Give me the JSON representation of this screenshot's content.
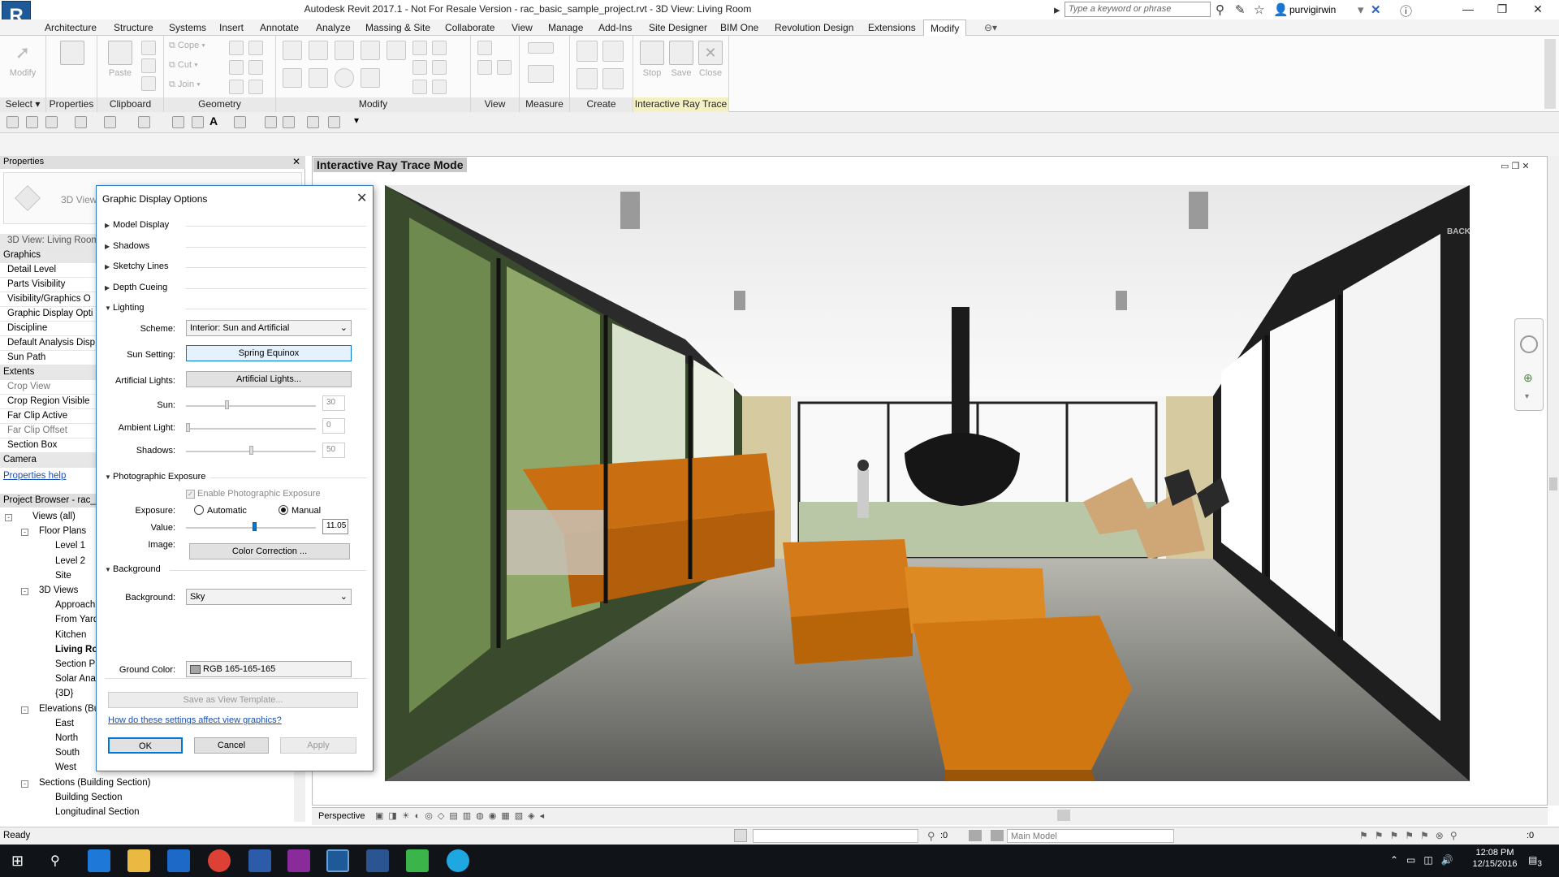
{
  "window": {
    "title": "Autodesk Revit 2017.1 -  Not For Resale Version -    rac_basic_sample_project.rvt - 3D View: Living Room",
    "app_logo": "R",
    "search_placeholder": "Type a keyword or phrase",
    "user": "purvigirwin"
  },
  "menu": {
    "tabs": [
      "Architecture",
      "Structure",
      "Systems",
      "Insert",
      "Annotate",
      "Analyze",
      "Massing & Site",
      "Collaborate",
      "View",
      "Manage",
      "Add-Ins",
      "Site Designer",
      "BIM One",
      "Revolution Design",
      "Extensions",
      "Modify"
    ],
    "active": "Modify"
  },
  "ribbon": {
    "modify_btn": "Modify",
    "properties_btn": "Properties",
    "paste_btn": "Paste",
    "cope": "Cope",
    "cut": "Cut",
    "join": "Join",
    "stop": "Stop",
    "save": "Save",
    "close": "Close",
    "panels": {
      "select": "Select",
      "properties": "Properties",
      "clipboard": "Clipboard",
      "geometry": "Geometry",
      "modify": "Modify",
      "view": "View",
      "measure": "Measure",
      "create": "Create",
      "raytrace": "Interactive Ray Trace"
    }
  },
  "properties": {
    "title": "Properties",
    "type_label": "3D View",
    "instance": "3D View: Living Room",
    "rows": [
      {
        "label": "Graphics",
        "kind": "sec"
      },
      {
        "label": "Detail Level",
        "kind": "row"
      },
      {
        "label": "Parts Visibility",
        "kind": "row"
      },
      {
        "label": "Visibility/Graphics O",
        "kind": "row"
      },
      {
        "label": "Graphic Display Opti",
        "kind": "row"
      },
      {
        "label": "Discipline",
        "kind": "row"
      },
      {
        "label": "Default Analysis Disp",
        "kind": "row"
      },
      {
        "label": "Sun Path",
        "kind": "row"
      },
      {
        "label": "Extents",
        "kind": "sec"
      },
      {
        "label": "Crop View",
        "kind": "gray"
      },
      {
        "label": "Crop Region Visible",
        "kind": "row"
      },
      {
        "label": "Far Clip Active",
        "kind": "row"
      },
      {
        "label": "Far Clip Offset",
        "kind": "gray"
      },
      {
        "label": "Section Box",
        "kind": "row"
      },
      {
        "label": "Camera",
        "kind": "sec"
      }
    ],
    "help_link": "Properties help"
  },
  "browser": {
    "title": "Project Browser - rac_b",
    "nodes": [
      {
        "label": "Views (all)",
        "level": 0,
        "exp": "-"
      },
      {
        "label": "Floor Plans",
        "level": 1,
        "exp": "-"
      },
      {
        "label": "Level 1",
        "level": 2,
        "exp": ""
      },
      {
        "label": "Level 2",
        "level": 2,
        "exp": ""
      },
      {
        "label": "Site",
        "level": 2,
        "exp": ""
      },
      {
        "label": "3D Views",
        "level": 1,
        "exp": "-"
      },
      {
        "label": "Approach",
        "level": 2,
        "exp": ""
      },
      {
        "label": "From Yard",
        "level": 2,
        "exp": ""
      },
      {
        "label": "Kitchen",
        "level": 2,
        "exp": ""
      },
      {
        "label": "Living Ro",
        "level": 2,
        "exp": "",
        "bold": true
      },
      {
        "label": "Section P",
        "level": 2,
        "exp": ""
      },
      {
        "label": "Solar Ana",
        "level": 2,
        "exp": ""
      },
      {
        "label": "{3D}",
        "level": 2,
        "exp": ""
      },
      {
        "label": "Elevations (Bu",
        "level": 1,
        "exp": "-"
      },
      {
        "label": "East",
        "level": 2,
        "exp": ""
      },
      {
        "label": "North",
        "level": 2,
        "exp": ""
      },
      {
        "label": "South",
        "level": 2,
        "exp": ""
      },
      {
        "label": "West",
        "level": 2,
        "exp": ""
      },
      {
        "label": "Sections (Building Section)",
        "level": 1,
        "exp": "-"
      },
      {
        "label": "Building Section",
        "level": 2,
        "exp": ""
      },
      {
        "label": "Longitudinal Section",
        "level": 2,
        "exp": ""
      }
    ]
  },
  "view": {
    "title": "Interactive Ray Trace Mode",
    "back_label": "BACK",
    "projection": "Perspective"
  },
  "dialog": {
    "title": "Graphic Display Options",
    "sections": {
      "model_display": "Model Display",
      "shadows": "Shadows",
      "sketchy": "Sketchy Lines",
      "depth": "Depth Cueing",
      "lighting": "Lighting",
      "photo": "Photographic Exposure",
      "background": "Background"
    },
    "scheme_label": "Scheme:",
    "scheme_value": "Interior: Sun and Artificial",
    "sun_setting_label": "Sun Setting:",
    "sun_setting_value": "Spring Equinox",
    "artificial_label": "Artificial Lights:",
    "artificial_btn": "Artificial Lights...",
    "sun_label": "Sun:",
    "sun_value": "30",
    "ambient_label": "Ambient Light:",
    "ambient_value": "0",
    "shadows_label": "Shadows:",
    "shadows_value": "50",
    "enable_exposure": "Enable Photographic Exposure",
    "exposure_label": "Exposure:",
    "automatic": "Automatic",
    "manual": "Manual",
    "value_label": "Value:",
    "value": "11.05",
    "image_label": "Image:",
    "color_correction": "Color Correction ...",
    "background_label": "Background:",
    "background_value": "Sky",
    "ground_label": "Ground Color:",
    "ground_value": "RGB 165-165-165",
    "save_template": "Save as View Template...",
    "help_link": "How do these settings affect view graphics?",
    "ok": "OK",
    "cancel": "Cancel",
    "apply": "Apply"
  },
  "status": {
    "text": "Ready",
    "zero1": ":0",
    "model": "Main Model",
    "zero2": ":0"
  },
  "taskbar": {
    "time": "12:08 PM",
    "date": "12/15/2016",
    "notif": "3"
  }
}
